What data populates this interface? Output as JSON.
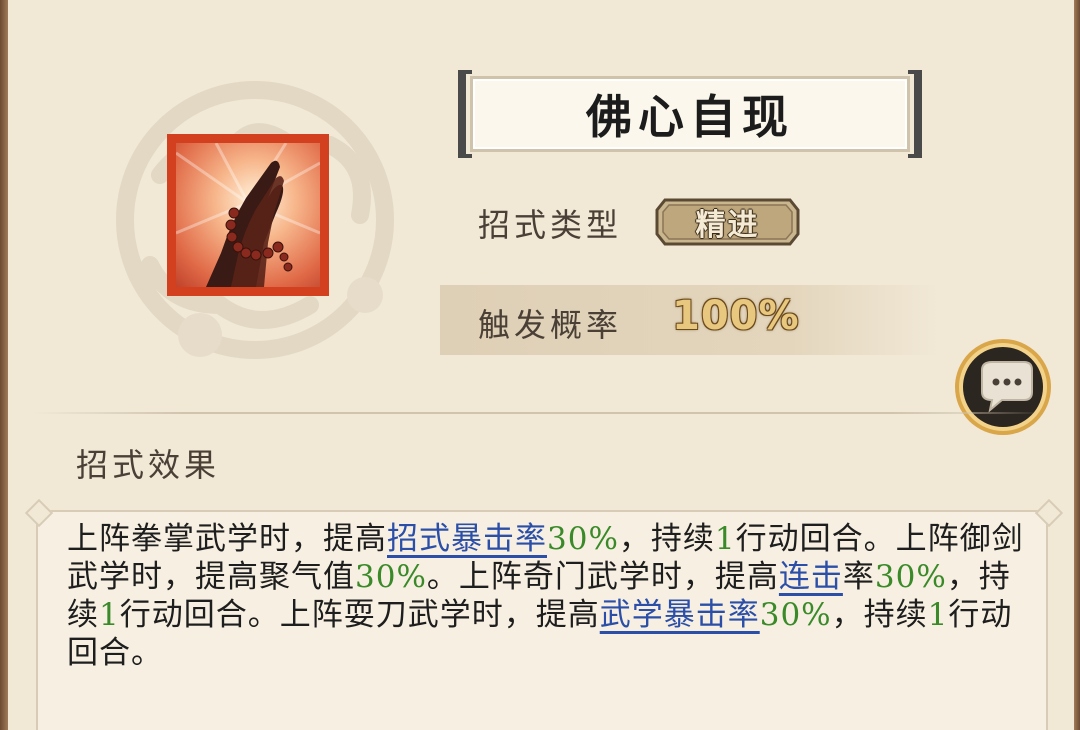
{
  "skill": {
    "name": "佛心自现",
    "icon": "praying-hands-with-beads-icon"
  },
  "type_row": {
    "label": "招式类型",
    "value": "精进"
  },
  "prob_row": {
    "label": "触发概率",
    "value": "100%"
  },
  "chat_button": {
    "icon": "speech-bubble-ellipsis-icon"
  },
  "effect": {
    "title": "招式效果",
    "segments": [
      {
        "text": "上阵拳掌武学时，提高",
        "style": "plain"
      },
      {
        "text": "招式暴击率",
        "style": "keyword"
      },
      {
        "text": "30%",
        "style": "number"
      },
      {
        "text": "，持续",
        "style": "plain"
      },
      {
        "text": "1",
        "style": "number"
      },
      {
        "text": "行动回合。上阵御剑武学时，提高聚气值",
        "style": "plain"
      },
      {
        "text": "30%",
        "style": "number"
      },
      {
        "text": "。上阵奇门武学时，提高",
        "style": "plain"
      },
      {
        "text": "连击",
        "style": "keyword"
      },
      {
        "text": "率",
        "style": "plain"
      },
      {
        "text": "30%",
        "style": "number"
      },
      {
        "text": "，持续",
        "style": "plain"
      },
      {
        "text": "1",
        "style": "number"
      },
      {
        "text": "行动回合。上阵耍刀武学时，提高",
        "style": "plain"
      },
      {
        "text": "武学暴击率",
        "style": "keyword"
      },
      {
        "text": "30%",
        "style": "number"
      },
      {
        "text": "，持续",
        "style": "plain"
      },
      {
        "text": "1",
        "style": "number"
      },
      {
        "text": "行动回合。",
        "style": "plain"
      }
    ]
  },
  "colors": {
    "background": "#f1e8d6",
    "keyword": "#2b4fa8",
    "number": "#3a8a2a",
    "icon_border": "#d2401f",
    "prob_value": "#e8c77e"
  }
}
